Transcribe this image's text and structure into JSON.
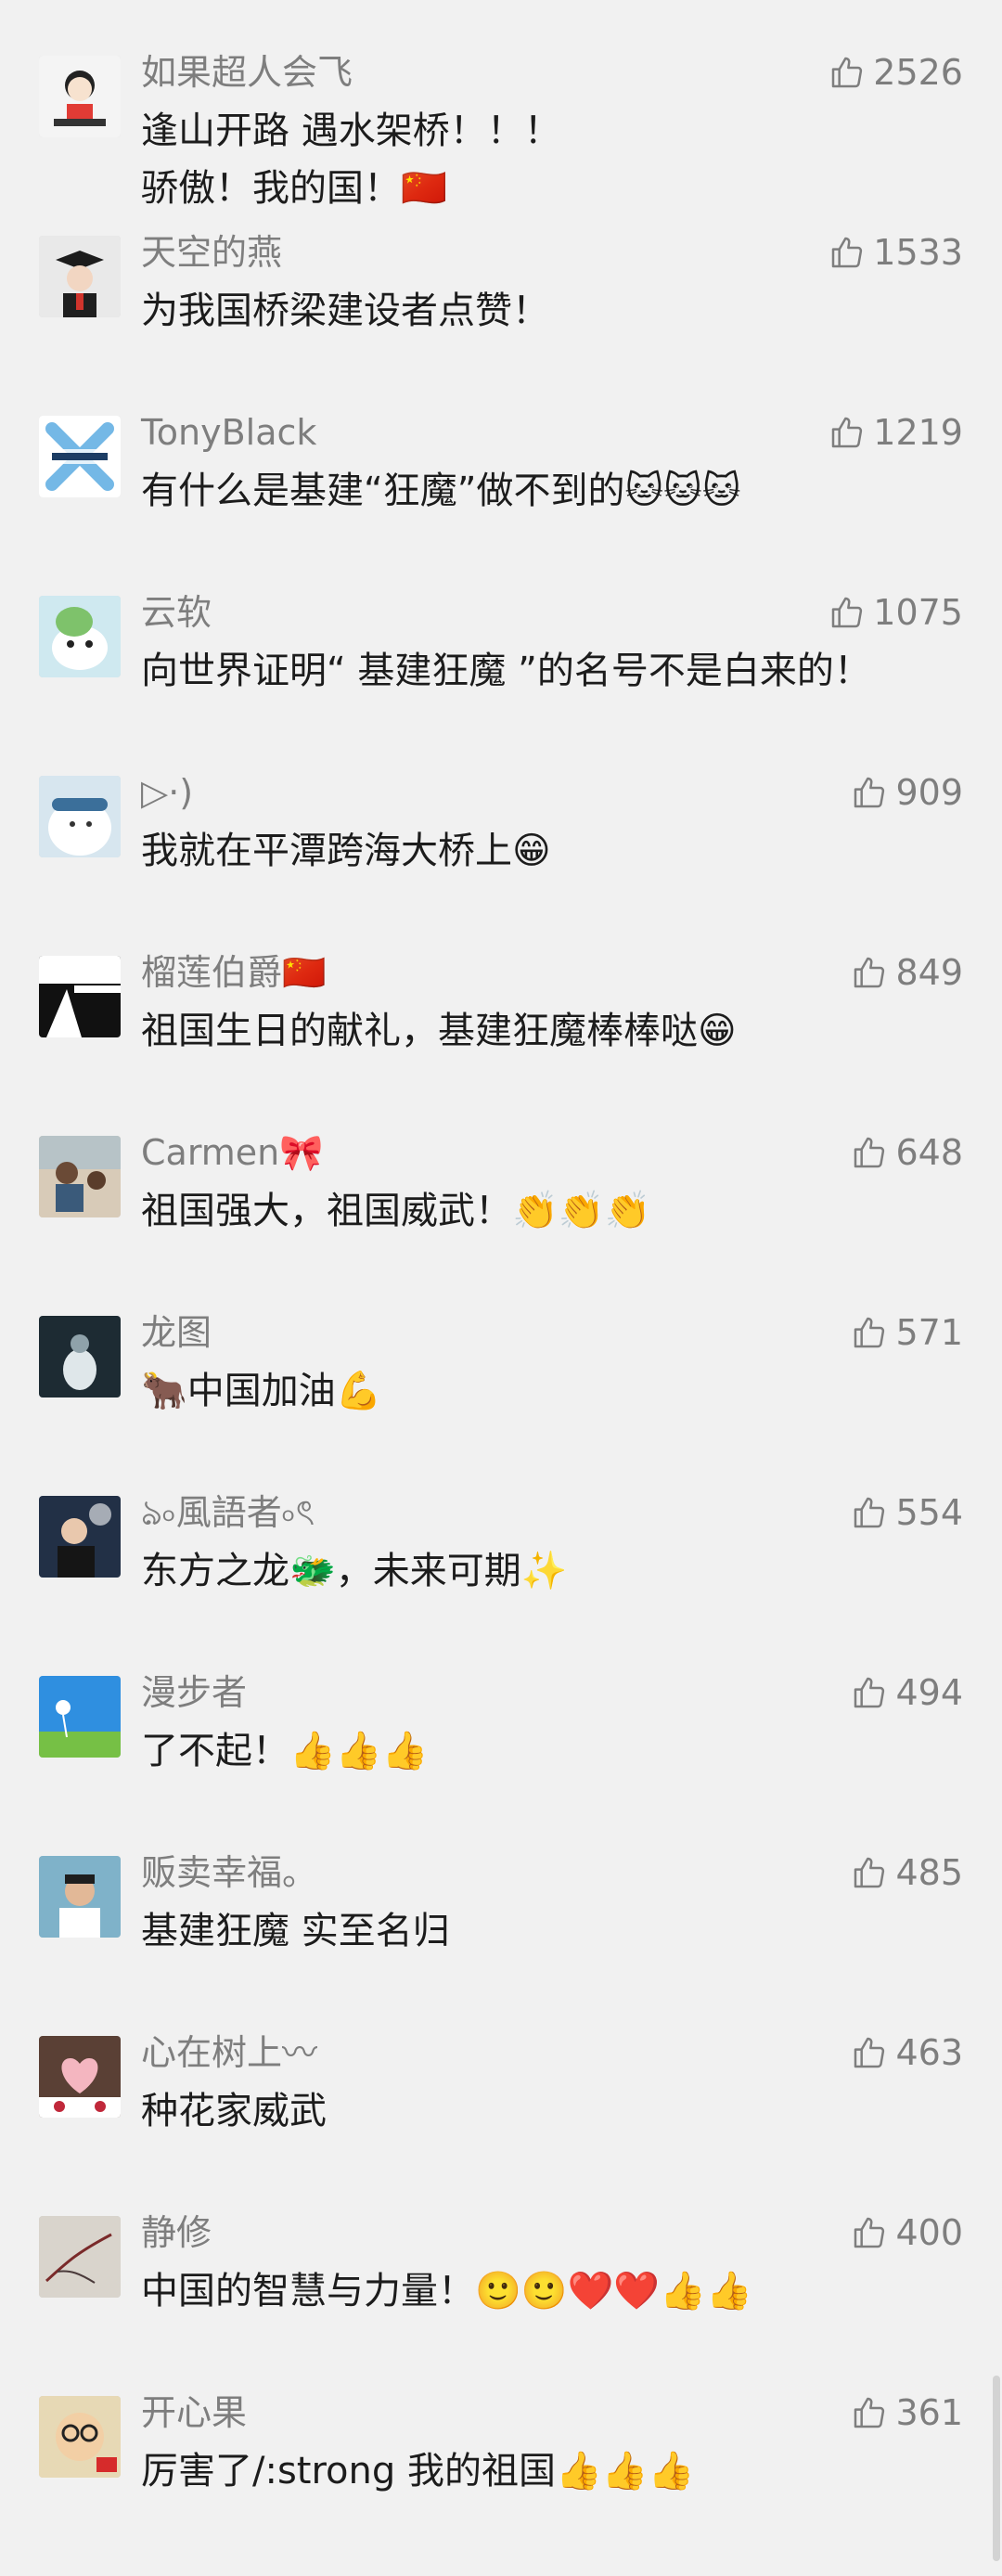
{
  "comments": [
    {
      "nickname": "如果超人会飞",
      "text": "逢山开路 遇水架桥！！！\n骄傲！我的国！🇨🇳",
      "likes": "2526"
    },
    {
      "nickname": "天空的燕",
      "text": "为我国桥梁建设者点赞！",
      "likes": "1533"
    },
    {
      "nickname": "TonyBlack",
      "text": "有什么是基建“狂魔”做不到的🐱🐱🐱",
      "likes": "1219"
    },
    {
      "nickname": "云软",
      "text": "向世界证明“ 基建狂魔 ”的名号不是白来的！",
      "likes": "1075"
    },
    {
      "nickname": "▷·)",
      "text": "我就在平潭跨海大桥上😁",
      "likes": "909"
    },
    {
      "nickname": "榴莲伯爵🇨🇳",
      "text": "祖国生日的献礼，基建狂魔棒棒哒😁",
      "likes": "849"
    },
    {
      "nickname": "Carmen🎀",
      "text": "祖国强大，祖国威武！👏👏👏",
      "likes": "648"
    },
    {
      "nickname": "龙图",
      "text": "🐂中国加油💪",
      "likes": "571"
    },
    {
      "nickname": "ঌ৹風語者৹ৎ",
      "text": "东方之龙🐲，未来可期✨",
      "likes": "554"
    },
    {
      "nickname": "漫步者",
      "text": "了不起！👍👍👍",
      "likes": "494"
    },
    {
      "nickname": "贩卖幸福。",
      "text": "基建狂魔  实至名归",
      "likes": "485"
    },
    {
      "nickname": "心在树上〰",
      "text": "种花家威武",
      "likes": "463"
    },
    {
      "nickname": "静修",
      "text": "中国的智慧与力量！🙂🙂❤️❤️👍👍",
      "likes": "400"
    },
    {
      "nickname": "开心果",
      "text": "厉害了/:strong 我的祖国👍👍👍",
      "likes": "361"
    }
  ],
  "icons": {
    "like": "thumbs-up-outline-icon"
  },
  "colors": {
    "background": "#f1f1f1",
    "nickname": "#7e7e7e",
    "text": "#1c1c1c",
    "like": "#7e7e7e"
  }
}
